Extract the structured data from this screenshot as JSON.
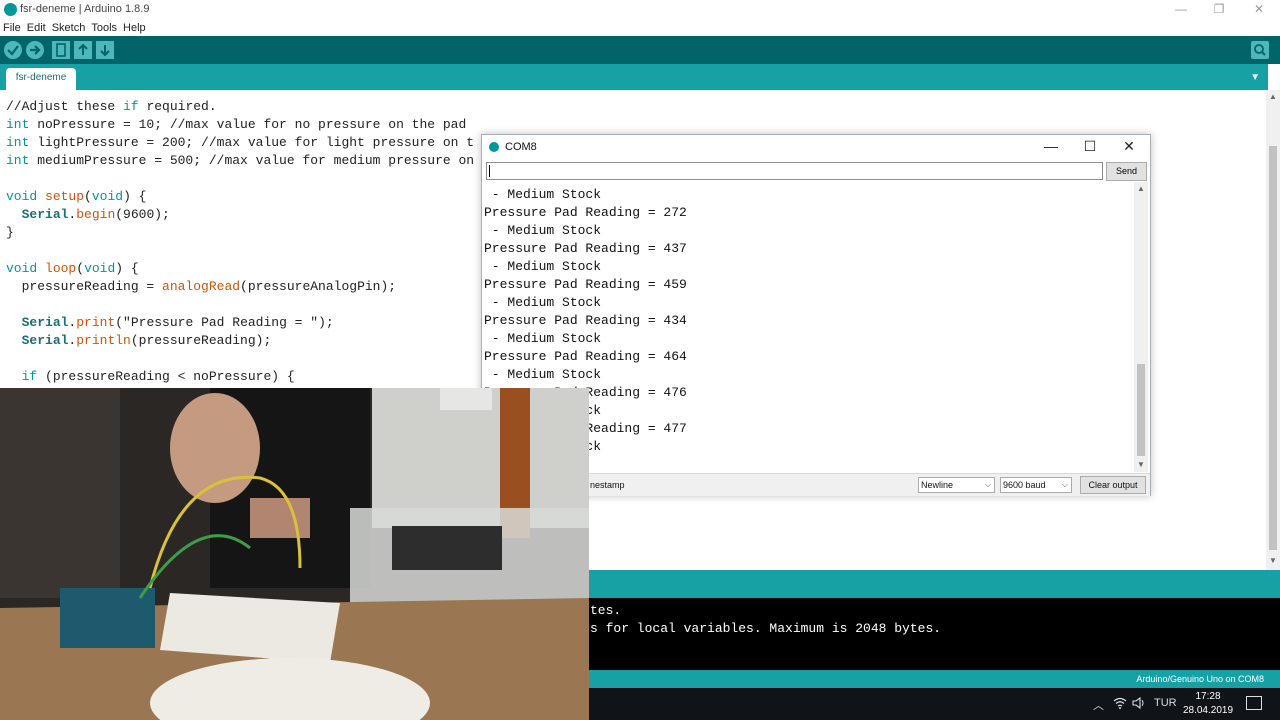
{
  "window": {
    "title": "fsr-deneme | Arduino 1.8.9",
    "minimize": "—",
    "maximize": "❐",
    "close": "✕"
  },
  "menu": [
    "File",
    "Edit",
    "Sketch",
    "Tools",
    "Help"
  ],
  "toolbar": {
    "verify_icon": "check-icon",
    "upload_icon": "arrow-right-icon",
    "new_icon": "file-icon",
    "open_icon": "arrow-up-icon",
    "save_icon": "arrow-down-icon",
    "serial_monitor_icon": "magnifier-icon"
  },
  "tab": {
    "label": "fsr-deneme",
    "menu": "▼"
  },
  "code_lines": [
    "//Adjust these if required.",
    "int noPressure = 10; //max value for no pressure on the pad",
    "int lightPressure = 200; //max value for light pressure on t",
    "int mediumPressure = 500; //max value for medium pressure on",
    "",
    "void setup(void) {",
    "  Serial.begin(9600);",
    "}",
    "",
    "void loop(void) {",
    "  pressureReading = analogRead(pressureAnalogPin);",
    "",
    "  Serial.print(\"Pressure Pad Reading = \");",
    "  Serial.println(pressureReading);",
    "",
    "  if (pressureReading < noPressure) {"
  ],
  "console_lines": [
    "tes.",
    "s for local variables. Maximum is 2048 bytes."
  ],
  "status": {
    "board": "Arduino/Genuino Uno on COM8"
  },
  "serial_monitor": {
    "title": "COM8",
    "input_value": "",
    "send_label": "Send",
    "output_lines": [
      " - Medium Stock",
      "Pressure Pad Reading = 272",
      " - Medium Stock",
      "Pressure Pad Reading = 437",
      " - Medium Stock",
      "Pressure Pad Reading = 459",
      " - Medium Stock",
      "Pressure Pad Reading = 434",
      " - Medium Stock",
      "Pressure Pad Reading = 464",
      " - Medium Stock",
      "Pressure Pad Reading = 476",
      " - Medium Stock",
      "Pressure Pad Reading = 477",
      " - Medium Stock"
    ],
    "timestamp_label": "nestamp",
    "line_ending": "Newline",
    "baud": "9600 baud",
    "clear_label": "Clear output"
  },
  "taskbar": {
    "language": "TUR",
    "time": "17:28",
    "date": "28.04.2019"
  },
  "colors": {
    "arduino_dark": "#006468",
    "arduino_teal": "#17a1a5",
    "keyword": "#00979c",
    "function": "#d35400"
  }
}
